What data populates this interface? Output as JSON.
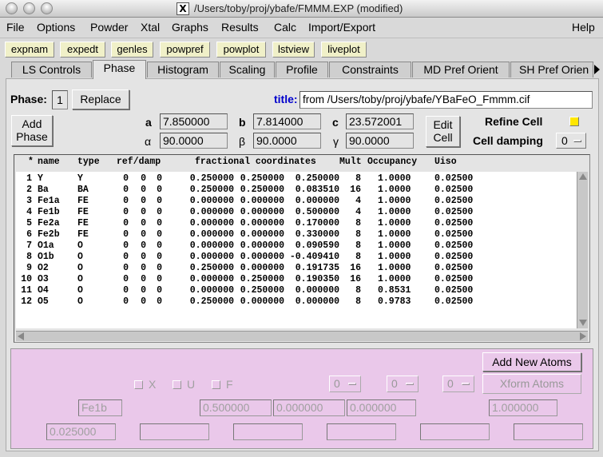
{
  "window": {
    "title": "/Users/toby/proj/ybafe/FMMM.EXP (modified)",
    "x_icon": "X"
  },
  "menubar": [
    "File",
    "Options",
    "Powder",
    "Xtal",
    "Graphs",
    "Results",
    "Calc",
    "Import/Export",
    "Help"
  ],
  "toolbar": [
    "expnam",
    "expedt",
    "genles",
    "powpref",
    "powplot",
    "lstview",
    "liveplot"
  ],
  "tabs": [
    "LS Controls",
    "Phase",
    "Histogram",
    "Scaling",
    "Profile",
    "Constraints",
    "MD Pref Orient",
    "SH Pref Orien"
  ],
  "active_tab": "Phase",
  "phase": {
    "label": "Phase:",
    "number": "1",
    "replace_button": "Replace",
    "title_label": "title:",
    "title_value": "from /Users/toby/proj/ybafe/YBaFeO_Fmmm.cif",
    "add_phase_button": "Add\nPhase",
    "edit_cell_button": "Edit\nCell",
    "refine_cell_label": "Refine Cell",
    "cell_damping_label": "Cell damping",
    "cell_damping_value": "0",
    "cell": {
      "a_label": "a",
      "a": "7.850000",
      "b_label": "b",
      "b": "7.814000",
      "c_label": "c",
      "c": "23.572001",
      "alpha_label": "α",
      "alpha": "90.0000",
      "beta_label": "β",
      "beta": "90.0000",
      "gamma_label": "γ",
      "gamma": "90.0000"
    }
  },
  "atoms": {
    "headers": [
      "*",
      "name",
      "type",
      "ref/damp",
      "fractional coordinates",
      "Mult",
      "Occupancy",
      "Uiso"
    ],
    "rows": [
      [
        "1",
        "Y",
        "Y",
        "0",
        "0",
        "0",
        "0.250000",
        "0.250000",
        "0.250000",
        "8",
        "1.0000",
        "0.02500"
      ],
      [
        "2",
        "Ba",
        "BA",
        "0",
        "0",
        "0",
        "0.250000",
        "0.250000",
        "0.083510",
        "16",
        "1.0000",
        "0.02500"
      ],
      [
        "3",
        "Fe1a",
        "FE",
        "0",
        "0",
        "0",
        "0.000000",
        "0.000000",
        "0.000000",
        "4",
        "1.0000",
        "0.02500"
      ],
      [
        "4",
        "Fe1b",
        "FE",
        "0",
        "0",
        "0",
        "0.000000",
        "0.000000",
        "0.500000",
        "4",
        "1.0000",
        "0.02500"
      ],
      [
        "5",
        "Fe2a",
        "FE",
        "0",
        "0",
        "0",
        "0.000000",
        "0.000000",
        "0.170000",
        "8",
        "1.0000",
        "0.02500"
      ],
      [
        "6",
        "Fe2b",
        "FE",
        "0",
        "0",
        "0",
        "0.000000",
        "0.000000",
        "0.330000",
        "8",
        "1.0000",
        "0.02500"
      ],
      [
        "7",
        "O1a",
        "O",
        "0",
        "0",
        "0",
        "0.000000",
        "0.000000",
        "0.090590",
        "8",
        "1.0000",
        "0.02500"
      ],
      [
        "8",
        "O1b",
        "O",
        "0",
        "0",
        "0",
        "0.000000",
        "0.000000",
        "-0.409410",
        "8",
        "1.0000",
        "0.02500"
      ],
      [
        "9",
        "O2",
        "O",
        "0",
        "0",
        "0",
        "0.250000",
        "0.000000",
        "0.191735",
        "16",
        "1.0000",
        "0.02500"
      ],
      [
        "10",
        "O3",
        "O",
        "0",
        "0",
        "0",
        "0.000000",
        "0.250000",
        "0.190350",
        "16",
        "1.0000",
        "0.02500"
      ],
      [
        "11",
        "O4",
        "O",
        "0",
        "0",
        "0",
        "0.000000",
        "0.250000",
        "0.000000",
        "8",
        "0.8531",
        "0.02500"
      ],
      [
        "12",
        "O5",
        "O",
        "0",
        "0",
        "0",
        "0.250000",
        "0.000000",
        "0.000000",
        "8",
        "0.9783",
        "0.02500"
      ]
    ]
  },
  "edit": {
    "add_new_atoms_button": "Add New Atoms",
    "xform_atoms_button": "Xform Atoms",
    "check_x": "X",
    "check_u": "U",
    "check_f": "F",
    "menu1": "0",
    "menu2": "0",
    "menu3": "0",
    "name": "Fe1b",
    "x": "0.500000",
    "y": "0.000000",
    "z": "0.000000",
    "occ": "1.000000",
    "uiso": "0.025000"
  },
  "colors": {
    "toolbar_bg": "#f0f0c8",
    "pink_bg": "#eac8ea",
    "refine_check": "#ffe600",
    "title_label": "#0000cc"
  }
}
